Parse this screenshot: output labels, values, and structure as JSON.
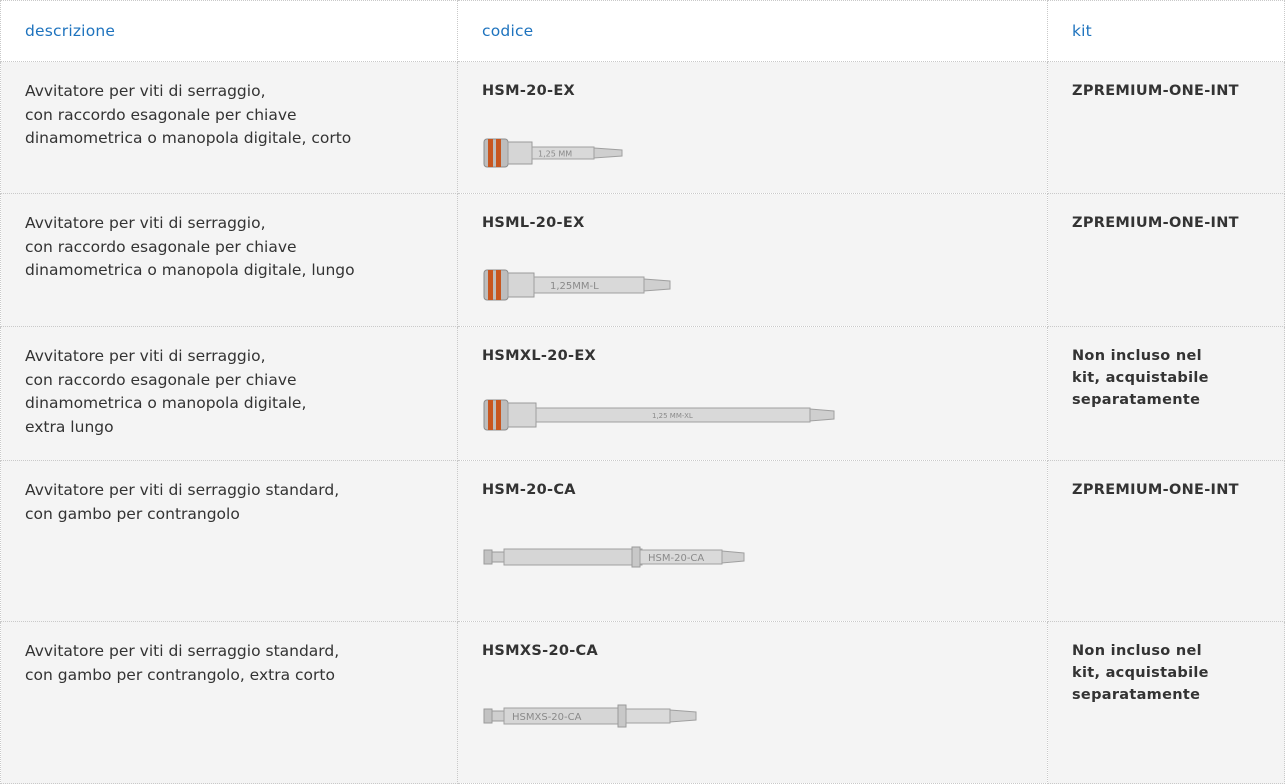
{
  "header": {
    "col_description": "descrizione",
    "col_code": "codice",
    "col_kit": "kit"
  },
  "rows": [
    {
      "description": [
        "Avvitatore per viti di serraggio,",
        "con raccordo esagonale per chiave",
        "dinamometrica o manopola digitale, corto"
      ],
      "code": "HSM-20-EX",
      "tool_marking": "1,25 MM",
      "kit": [
        "ZPREMIUM-ONE-INT"
      ]
    },
    {
      "description": [
        "Avvitatore per viti di serraggio,",
        "con raccordo esagonale per chiave",
        "dinamometrica o manopola digitale, lungo"
      ],
      "code": "HSML-20-EX",
      "tool_marking": "1,25MM-L",
      "kit": [
        "ZPREMIUM-ONE-INT"
      ]
    },
    {
      "description": [
        "Avvitatore per viti di serraggio,",
        "con raccordo esagonale per chiave",
        "dinamometrica o manopola digitale,",
        "extra lungo"
      ],
      "code": "HSMXL-20-EX",
      "tool_marking": "1,25 MM-XL",
      "kit": [
        "Non incluso nel",
        "kit, acquistabile",
        "separatamente"
      ]
    },
    {
      "description": [
        "Avvitatore per viti di serraggio standard,",
        "con gambo per contrangolo"
      ],
      "code": "HSM-20-CA",
      "tool_marking": "HSM-20-CA",
      "kit": [
        "ZPREMIUM-ONE-INT"
      ]
    },
    {
      "description": [
        "Avvitatore per viti di serraggio standard,",
        "con gambo per contrangolo, extra corto"
      ],
      "code": "HSMXS-20-CA",
      "tool_marking": "HSMXS-20-CA",
      "kit": [
        "Non incluso nel",
        "kit, acquistabile",
        "separatamente"
      ]
    }
  ],
  "colors": {
    "header_text": "#1e73be",
    "row_background": "#f4f4f4",
    "o_ring": "#c8561f"
  }
}
